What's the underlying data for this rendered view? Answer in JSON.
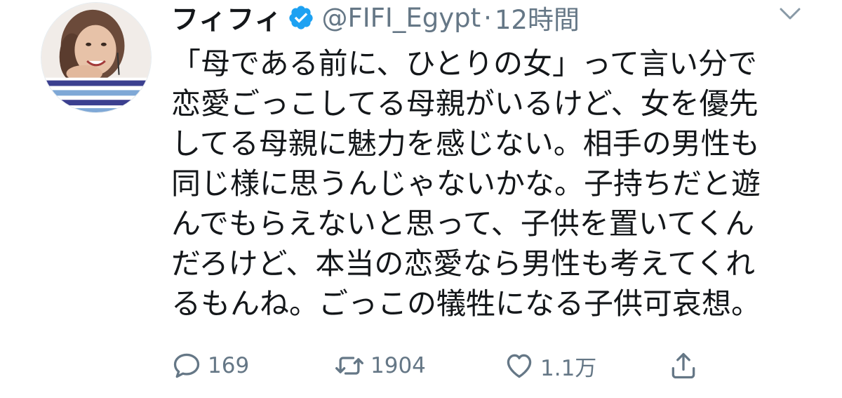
{
  "tweet": {
    "display_name": "フィフィ",
    "handle": "@FIFI_Egypt",
    "separator": "·",
    "time": "12時間",
    "verified": true,
    "text_lines": [
      "「母である前に、ひとりの女」って言い分で",
      "恋愛ごっこしてる母親がいるけど、女を優先",
      "してる母親に魅力を感じない。相手の男性も",
      "同じ様に思うんじゃないかな。子持ちだと遊",
      "んでもらえないと思って、子供を置いてくん",
      "だろけど、本当の恋愛なら男性も考えてくれ",
      "るもんね。ごっこの犠牲になる子供可哀想。"
    ]
  },
  "actions": {
    "reply_count": "169",
    "retweet_count": "1904",
    "like_count": "1.1万"
  },
  "icons": {
    "verified": "verified-badge-icon",
    "caret": "chevron-down-icon",
    "reply": "reply-icon",
    "retweet": "retweet-icon",
    "like": "heart-icon",
    "share": "share-icon"
  },
  "colors": {
    "text": "#14171a",
    "muted": "#657786",
    "verified": "#1da1f2"
  }
}
